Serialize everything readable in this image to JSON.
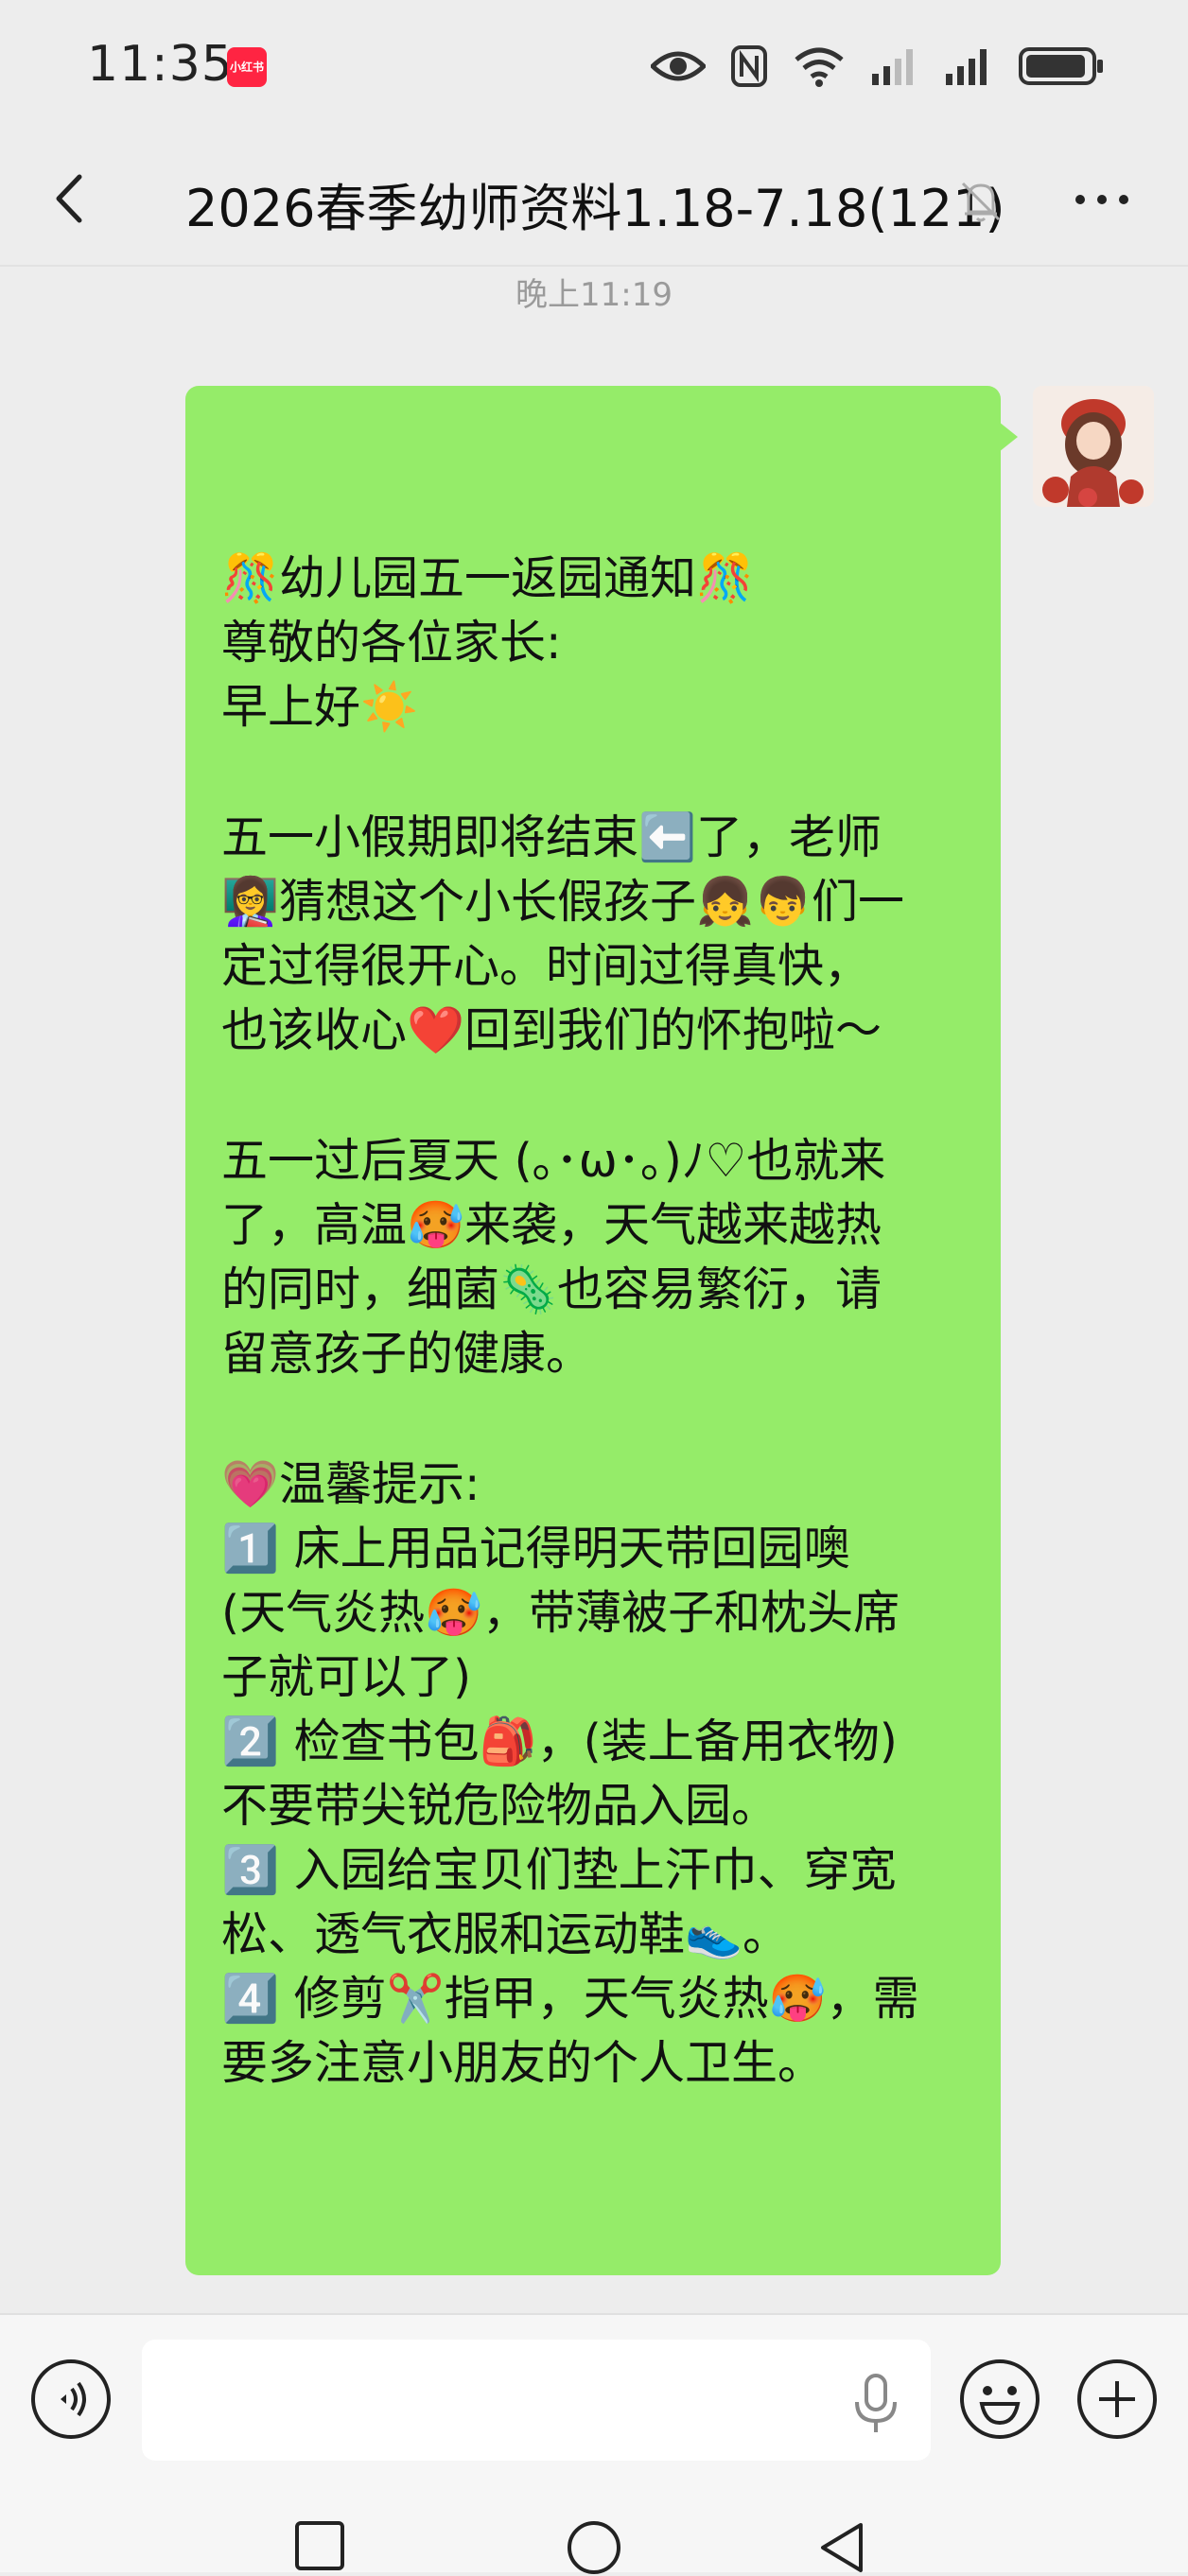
{
  "status_bar": {
    "time": "11:35",
    "app_badge": "小红书",
    "icons": [
      "eye-icon",
      "nfc-icon",
      "wifi-icon",
      "signal-1-icon",
      "signal-2-icon",
      "battery-icon"
    ]
  },
  "header": {
    "title": "2026春季幼师资料1.18-7.18(121)",
    "back_icon": "chevron-left-icon",
    "mute_icon": "bell-muted-icon",
    "more_icon": "more-dots-icon"
  },
  "chat": {
    "time_label": "晚上11:19",
    "bubble_color": "#95ec69",
    "message_lines": [
      "🎊幼儿园五一返园通知🎊",
      "尊敬的各位家长:",
      "早上好☀️",
      "",
      "五一小假期即将结束⬅️了，老师",
      "👩‍🏫猜想这个小长假孩子👧👦们一",
      "定过得很开心。时间过得真快，",
      "也该收心❤️回到我们的怀抱啦～",
      "",
      "五一过后夏天 (｡･ω･｡)ﾉ♡也就来",
      "了，高温🥵来袭，天气越来越热",
      "的同时，细菌🦠也容易繁衍，请",
      "留意孩子的健康。",
      "",
      "💗温馨提示:",
      "1️⃣ 床上用品记得明天带回园噢",
      "(天气炎热🥵，带薄被子和枕头席",
      "子就可以了)",
      "2️⃣ 检查书包🎒，(装上备用衣物)",
      "不要带尖锐危险物品入园。",
      "3️⃣ 入园给宝贝们垫上汗巾、穿宽",
      "松、透气衣服和运动鞋👟。",
      "4️⃣ 修剪✂️指甲，天气炎热🥵，需",
      "要多注意小朋友的个人卫生。"
    ]
  },
  "input_bar": {
    "input_value": "",
    "voice_icon": "voice-icon",
    "mic_icon": "microphone-icon",
    "emoji_icon": "emoji-icon",
    "plus_icon": "plus-icon"
  },
  "nav_bar": {
    "icons": [
      "square-icon",
      "circle-icon",
      "triangle-back-icon"
    ]
  }
}
